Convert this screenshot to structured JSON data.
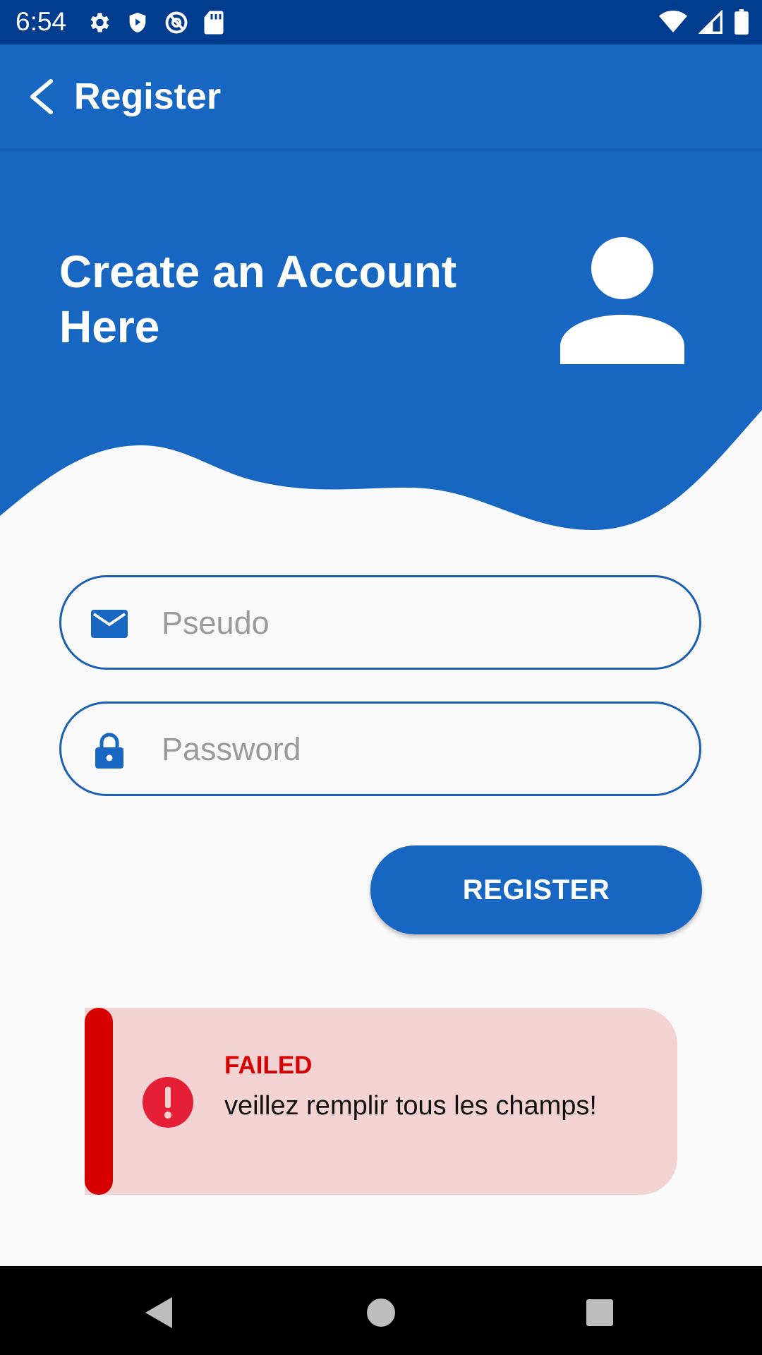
{
  "status_bar": {
    "time": "6:54",
    "icons_left": [
      "gear-icon",
      "shield-icon",
      "at-sign-icon",
      "sd-card-icon"
    ],
    "icons_right": [
      "wifi-icon",
      "signal-icon",
      "battery-icon"
    ]
  },
  "app_bar": {
    "title": "Register",
    "back_icon": "chevron-left-icon"
  },
  "hero": {
    "title": "Create an Account Here",
    "avatar_icon": "person-icon"
  },
  "form": {
    "pseudo": {
      "placeholder": "Pseudo",
      "value": "",
      "icon": "mail-icon"
    },
    "password": {
      "placeholder": "Password",
      "value": "",
      "icon": "lock-icon"
    },
    "register_label": "REGISTER"
  },
  "alert": {
    "title": "FAILED",
    "message": "veillez remplir tous les champs!",
    "icon": "error-icon"
  },
  "nav_bar": {
    "buttons": [
      "back-triangle-icon",
      "home-circle-icon",
      "recents-square-icon"
    ]
  },
  "colors": {
    "primary": "#1767c2",
    "status_bar": "#013d8e",
    "error": "#d60000",
    "alert_bg": "#f2d2d3",
    "background": "#f9f9fa"
  }
}
